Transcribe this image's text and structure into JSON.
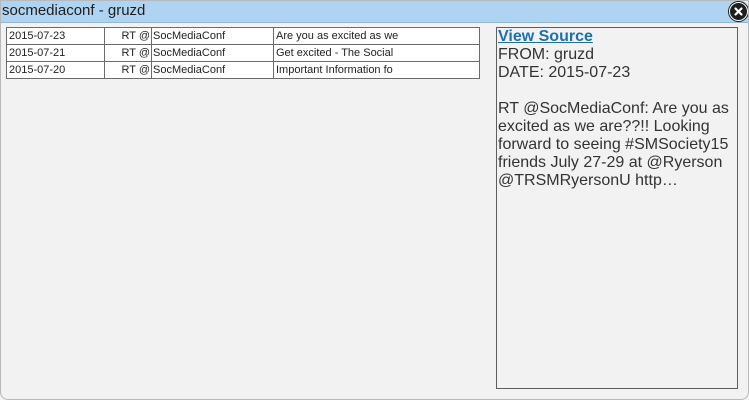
{
  "window": {
    "title": "socmediaconf - gruzd",
    "close_icon": "close-icon"
  },
  "tweets": [
    {
      "date": "2015-07-23",
      "rt": "RT @",
      "user": "SocMediaConf",
      "text": "Are you as excited as we"
    },
    {
      "date": "2015-07-21",
      "rt": "RT @",
      "user": "SocMediaConf",
      "text": "Get excited - The Social"
    },
    {
      "date": "2015-07-20",
      "rt": "RT @",
      "user": "SocMediaConf",
      "text": "Important Information fo"
    }
  ],
  "detail": {
    "view_source_label": "View Source",
    "from_line": "FROM: gruzd",
    "date_line": "DATE: 2015-07-23",
    "body": "RT @SocMediaConf: Are you as excited as we are??!! Looking forward to seeing #SMSociety15 friends July 27-29 at @Ryerson @TRSMRyersonU http…"
  },
  "colors": {
    "titlebar": "#aed4f2",
    "link": "#1d6fb0",
    "background": "#f2f2f2"
  }
}
